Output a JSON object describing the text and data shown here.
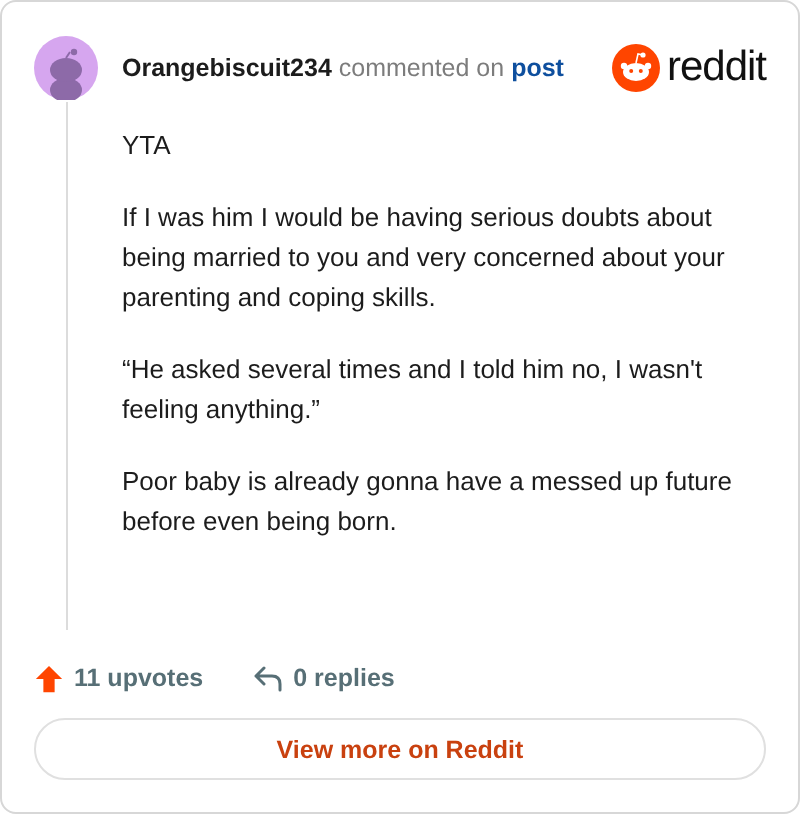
{
  "comment": {
    "author": "Orangebiscuit234",
    "action": "commented on",
    "target": "post",
    "paragraphs": [
      "YTA",
      "If I was him I would be having serious doubts about being married to you and very concerned about your parenting and coping skills.",
      "“He asked several times and I told him no, I wasn't feeling anything.”",
      "Poor baby is already gonna have a messed up future before even being born."
    ]
  },
  "brand": {
    "name": "reddit"
  },
  "stats": {
    "upvotes": "11 upvotes",
    "replies": "0 replies"
  },
  "button": "View more on Reddit"
}
